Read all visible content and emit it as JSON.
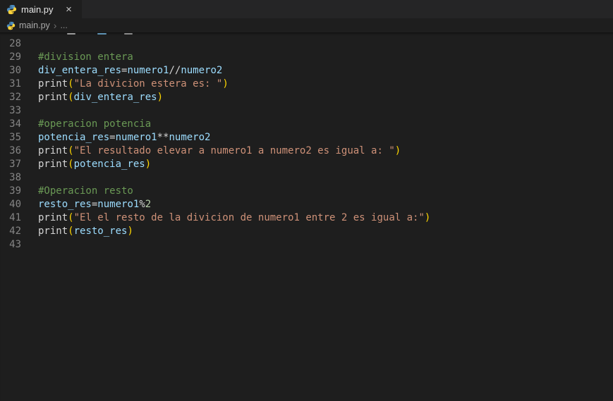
{
  "tab_bar": {
    "tabs": [
      {
        "label": "main.py",
        "icon": "python-icon",
        "close_glyph": "×",
        "active": true
      }
    ]
  },
  "breadcrumb": {
    "file": "main.py",
    "separator": "›",
    "ellipsis": "..."
  },
  "colors": {
    "editor_bg": "#1e1e1e",
    "tab_bar_bg": "#252526",
    "active_tab_bg": "#1e1e1e",
    "line_number": "#858585",
    "python_blue": "#4B8BBE",
    "python_yellow": "#FFD43B",
    "tokens": {
      "comment": "#6a9955",
      "var": "#9cdcfe",
      "op": "#d4d4d4",
      "fn": "#d4d4d4",
      "paren": "#ffd700",
      "str": "#ce9178",
      "num": "#b5cea8"
    }
  },
  "editor": {
    "language": "python",
    "lines": [
      {
        "number": "28",
        "tokens": []
      },
      {
        "number": "29",
        "tokens": [
          {
            "t": "#division entera",
            "c": "comment"
          }
        ]
      },
      {
        "number": "30",
        "tokens": [
          {
            "t": "div_entera_res",
            "c": "var"
          },
          {
            "t": "=",
            "c": "op"
          },
          {
            "t": "numero1",
            "c": "var"
          },
          {
            "t": "//",
            "c": "op"
          },
          {
            "t": "numero2",
            "c": "var"
          }
        ]
      },
      {
        "number": "31",
        "tokens": [
          {
            "t": "print",
            "c": "fn"
          },
          {
            "t": "(",
            "c": "paren"
          },
          {
            "t": "\"La divicion estera es: \"",
            "c": "str"
          },
          {
            "t": ")",
            "c": "paren"
          }
        ]
      },
      {
        "number": "32",
        "tokens": [
          {
            "t": "print",
            "c": "fn"
          },
          {
            "t": "(",
            "c": "paren"
          },
          {
            "t": "div_entera_res",
            "c": "var"
          },
          {
            "t": ")",
            "c": "paren"
          }
        ]
      },
      {
        "number": "33",
        "tokens": []
      },
      {
        "number": "34",
        "tokens": [
          {
            "t": "#operacion potencia",
            "c": "comment"
          }
        ]
      },
      {
        "number": "35",
        "tokens": [
          {
            "t": "potencia_res",
            "c": "var"
          },
          {
            "t": "=",
            "c": "op"
          },
          {
            "t": "numero1",
            "c": "var"
          },
          {
            "t": "**",
            "c": "op"
          },
          {
            "t": "numero2",
            "c": "var"
          }
        ]
      },
      {
        "number": "36",
        "tokens": [
          {
            "t": "print",
            "c": "fn"
          },
          {
            "t": "(",
            "c": "paren"
          },
          {
            "t": "\"El resultado elevar a numero1 a numero2 es igual a: \"",
            "c": "str"
          },
          {
            "t": ")",
            "c": "paren"
          }
        ]
      },
      {
        "number": "37",
        "tokens": [
          {
            "t": "print",
            "c": "fn"
          },
          {
            "t": "(",
            "c": "paren"
          },
          {
            "t": "potencia_res",
            "c": "var"
          },
          {
            "t": ")",
            "c": "paren"
          }
        ]
      },
      {
        "number": "38",
        "tokens": []
      },
      {
        "number": "39",
        "tokens": [
          {
            "t": "#Operacion resto",
            "c": "comment"
          }
        ]
      },
      {
        "number": "40",
        "tokens": [
          {
            "t": "resto_res",
            "c": "var"
          },
          {
            "t": "=",
            "c": "op"
          },
          {
            "t": "numero1",
            "c": "var"
          },
          {
            "t": "%",
            "c": "op"
          },
          {
            "t": "2",
            "c": "num"
          }
        ]
      },
      {
        "number": "41",
        "tokens": [
          {
            "t": "print",
            "c": "fn"
          },
          {
            "t": "(",
            "c": "paren"
          },
          {
            "t": "\"El el resto de la divicion de numero1 entre 2 es igual a:\"",
            "c": "str"
          },
          {
            "t": ")",
            "c": "paren"
          }
        ]
      },
      {
        "number": "42",
        "tokens": [
          {
            "t": "print",
            "c": "fn"
          },
          {
            "t": "(",
            "c": "paren"
          },
          {
            "t": "resto_res",
            "c": "var"
          },
          {
            "t": ")",
            "c": "paren"
          }
        ]
      },
      {
        "number": "43",
        "tokens": []
      }
    ]
  }
}
